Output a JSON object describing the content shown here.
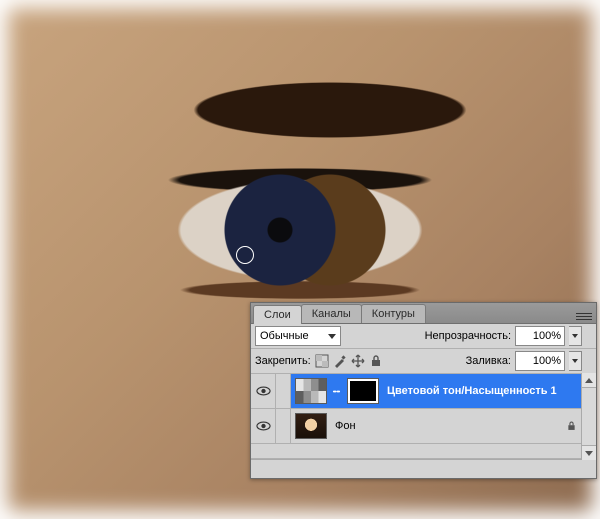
{
  "panel": {
    "tabs": [
      {
        "label": "Слои",
        "active": true
      },
      {
        "label": "Каналы",
        "active": false
      },
      {
        "label": "Контуры",
        "active": false
      }
    ],
    "blend_mode": {
      "value": "Обычные"
    },
    "opacity": {
      "label": "Непрозрачность:",
      "value": "100%"
    },
    "lock": {
      "label": "Закрепить:"
    },
    "fill": {
      "label": "Заливка:",
      "value": "100%"
    },
    "layers": [
      {
        "name": "Цветовой тон/Насыщенность 1",
        "kind": "adjustment",
        "selected": true,
        "visible": true,
        "locked": false
      },
      {
        "name": "Фон",
        "kind": "background",
        "selected": false,
        "visible": true,
        "locked": true
      }
    ],
    "icons": {
      "lock_pixels": "lock-pixels-icon",
      "brush": "brush-icon",
      "move": "move-icon",
      "lock_all": "lock-all-icon",
      "eye": "eye-icon",
      "link": "chain-link-icon",
      "padlock": "padlock-icon",
      "menu": "panel-menu-icon"
    }
  }
}
